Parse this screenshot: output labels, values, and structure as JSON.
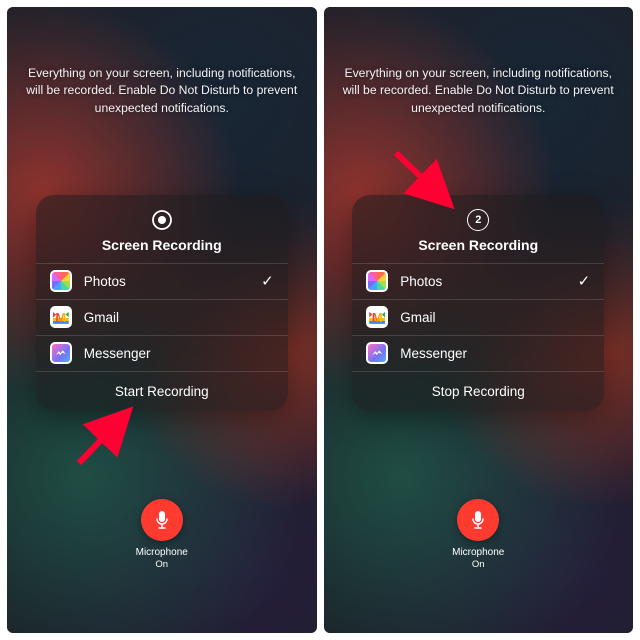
{
  "instruction": "Everything on your screen, including notifications, will be recorded. Enable Do Not Disturb to prevent unexpected notifications.",
  "panels": {
    "left": {
      "card_title": "Screen Recording",
      "icon_mode": "record",
      "countdown": "",
      "apps": [
        {
          "name": "Photos",
          "icon": "photos",
          "selected": true
        },
        {
          "name": "Gmail",
          "icon": "gmail",
          "selected": false
        },
        {
          "name": "Messenger",
          "icon": "messenger",
          "selected": false
        }
      ],
      "action_label": "Start Recording"
    },
    "right": {
      "card_title": "Screen Recording",
      "icon_mode": "countdown",
      "countdown": "2",
      "apps": [
        {
          "name": "Photos",
          "icon": "photos",
          "selected": true
        },
        {
          "name": "Gmail",
          "icon": "gmail",
          "selected": false
        },
        {
          "name": "Messenger",
          "icon": "messenger",
          "selected": false
        }
      ],
      "action_label": "Stop Recording"
    }
  },
  "mic": {
    "label": "Microphone",
    "status": "On"
  },
  "colors": {
    "accent_red": "#ff3b30"
  }
}
